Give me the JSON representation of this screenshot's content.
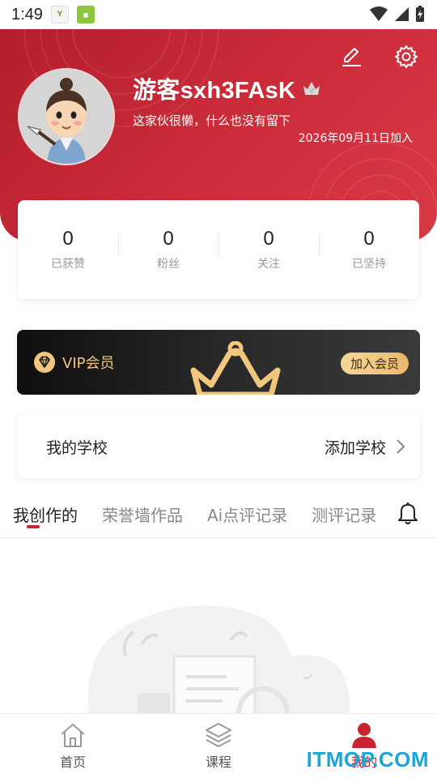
{
  "status_bar": {
    "time": "1:49"
  },
  "profile": {
    "username": "游客sxh3FAsK",
    "signature": "这家伙很懒，什么也没有留下",
    "join_date": "2026年09月11日加入"
  },
  "stats": [
    {
      "value": "0",
      "label": "已获赞"
    },
    {
      "value": "0",
      "label": "粉丝"
    },
    {
      "value": "0",
      "label": "关注"
    },
    {
      "value": "0",
      "label": "已坚持"
    }
  ],
  "vip": {
    "title": "VIP会员",
    "join_button": "加入会员"
  },
  "school": {
    "label": "我的学校",
    "action": "添加学校"
  },
  "tabs": [
    {
      "label": "我创作的",
      "active": true
    },
    {
      "label": "荣誉墙作品",
      "active": false
    },
    {
      "label": "Ai点评记录",
      "active": false
    },
    {
      "label": "测评记录",
      "active": false
    }
  ],
  "bottom_nav": [
    {
      "label": "首页",
      "icon": "home-icon",
      "active": false
    },
    {
      "label": "课程",
      "icon": "layers-icon",
      "active": false
    },
    {
      "label": "我的",
      "icon": "user-icon",
      "active": true
    }
  ],
  "watermark": "ITMOP.COM",
  "colors": {
    "brand_red": "#c8232f",
    "vip_gold": "#f1c77e"
  }
}
